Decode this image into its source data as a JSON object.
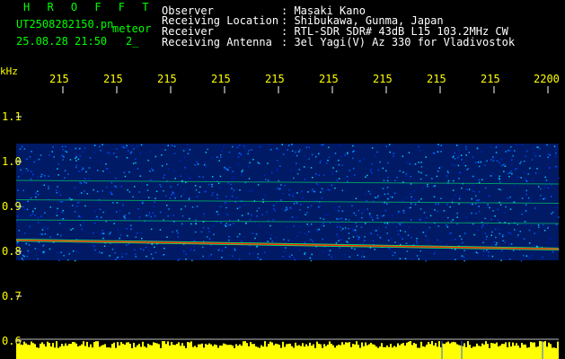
{
  "header": {
    "program": "H R O F F T",
    "filename": "UT2508282150.pn",
    "mode": "meteor",
    "datetime": "25.08.28 21:50",
    "index": "2_",
    "info": [
      {
        "label": "Observer",
        "value": ": Masaki Kano"
      },
      {
        "label": "Receiving Location",
        "value": ": Shibukawa, Gunma, Japan"
      },
      {
        "label": "Receiver",
        "value": ": RTL-SDR SDR# 43dB L15 103.2MHz CW"
      },
      {
        "label": "Receiving Antenna",
        "value": ": 3el Yagi(V) Az 330 for Vladivostok"
      }
    ]
  },
  "time_axis": {
    "ticks": [
      "215",
      "215",
      "215",
      "215",
      "215",
      "215",
      "215",
      "215",
      "215",
      "2200"
    ]
  },
  "freq_axis": {
    "unit": "kHz",
    "ticks": [
      "1.1",
      "1.0",
      "0.9",
      "0.8",
      "0.7",
      "0.6"
    ]
  },
  "spectrogram": {
    "band_top_khz": 1.04,
    "band_bottom_khz": 0.78,
    "carrier_start_khz": 0.825,
    "carrier_end_khz": 0.805,
    "colors": {
      "background": "#000000",
      "noise": "#0033ff",
      "carrier": "#ff2200",
      "trace": "#00ff66",
      "level_bar": "#ffff00",
      "grid": "#ffffff"
    }
  }
}
